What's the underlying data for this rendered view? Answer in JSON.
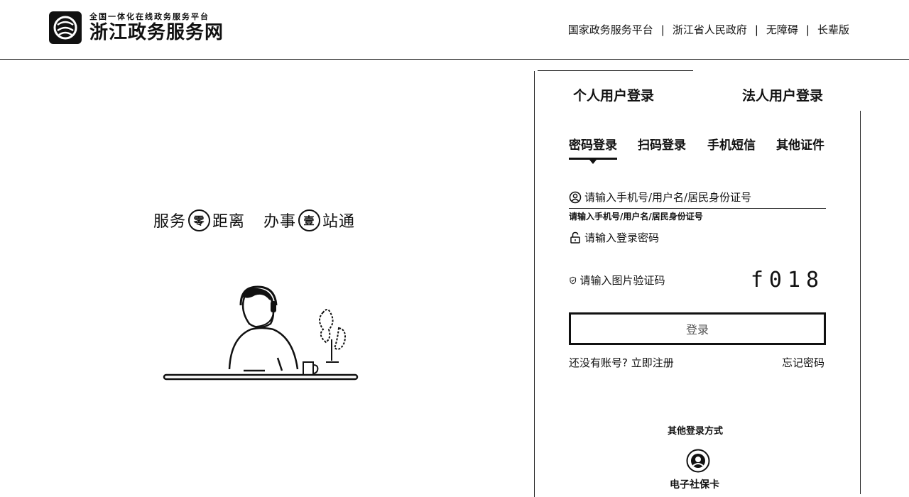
{
  "header": {
    "logo_subtitle": "全国一体化在线政务服务平台",
    "logo_title": "浙江政务服务网",
    "nav": [
      {
        "label": "国家政务服务平台"
      },
      {
        "label": "浙江省人民政府"
      },
      {
        "label": "无障碍"
      },
      {
        "label": "长辈版"
      }
    ]
  },
  "slogan": {
    "part1": "服务",
    "circle1": "零",
    "part2": "距离",
    "part3": "办事",
    "circle2": "壹",
    "part4": "站通"
  },
  "login": {
    "user_tabs": [
      {
        "label": "个人用户登录",
        "active": true
      },
      {
        "label": "法人用户登录",
        "active": false
      }
    ],
    "method_tabs": [
      {
        "label": "密码登录",
        "active": true
      },
      {
        "label": "扫码登录",
        "active": false
      },
      {
        "label": "手机短信",
        "active": false
      },
      {
        "label": "其他证件",
        "active": false
      }
    ],
    "username_placeholder": "请输入手机号/用户名/居民身份证号",
    "username_hint": "请输入手机号/用户名/居民身份证号",
    "password_placeholder": "请输入登录密码",
    "captcha_placeholder": "请输入图片验证码",
    "captcha_text": "f018",
    "submit_label": "登录",
    "register_prompt": "还没有账号?",
    "register_link": "立即注册",
    "forgot_link": "忘记密码",
    "other_methods_label": "其他登录方式",
    "ssc_label": "电子社保卡"
  },
  "icons": {
    "user": "user-icon",
    "lock": "lock-icon",
    "shield": "shield-icon",
    "logo": "zhejiang-logo-icon",
    "ssc": "social-security-card-icon"
  }
}
